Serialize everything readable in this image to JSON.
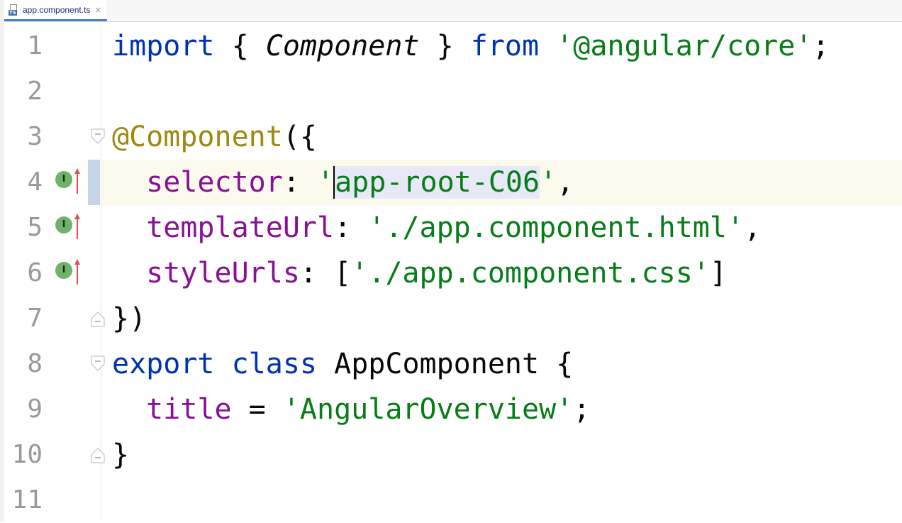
{
  "tab": {
    "filename": "app.component.ts",
    "icon": "typescript-file-icon",
    "icon_label": "TS",
    "close": "×"
  },
  "gutter": {
    "implement_marker": "I",
    "implement_icon": "implement-method-icon",
    "arrow_icon": "override-up-arrow-icon"
  },
  "lines": [
    {
      "n": "1"
    },
    {
      "n": "2"
    },
    {
      "n": "3"
    },
    {
      "n": "4"
    },
    {
      "n": "5"
    },
    {
      "n": "6"
    },
    {
      "n": "7"
    },
    {
      "n": "8"
    },
    {
      "n": "9"
    },
    {
      "n": "10"
    },
    {
      "n": "11"
    }
  ],
  "code": {
    "l1": {
      "import": "import",
      "open": " { ",
      "component": "Component",
      "close": " } ",
      "from": "from",
      "sp": " ",
      "module": "'@angular/core'",
      "semi": ";"
    },
    "l3": {
      "decorator": "@Component",
      "paren": "({"
    },
    "l4": {
      "key": "selector",
      "colon": ": ",
      "q1": "'",
      "value": "app-root-C06",
      "q2": "'",
      "comma": ","
    },
    "l5": {
      "key": "templateUrl",
      "colon": ": ",
      "value": "'./app.component.html'",
      "comma": ","
    },
    "l6": {
      "key": "styleUrls",
      "colon": ": [",
      "value": "'./app.component.css'",
      "end": "]"
    },
    "l7": {
      "text": "})"
    },
    "l8": {
      "export": "export",
      "sp1": " ",
      "class": "class",
      "sp2": " ",
      "name": "AppComponent",
      "brace": " {"
    },
    "l9": {
      "key": "title",
      "eq": " = ",
      "value": "'AngularOverview'",
      "semi": ";"
    },
    "l10": {
      "text": "}"
    }
  },
  "colors": {
    "keyword": "#0033b3",
    "string": "#067d17",
    "property": "#871094",
    "annotation": "#9e880d",
    "current_line": "#fcfaed"
  }
}
